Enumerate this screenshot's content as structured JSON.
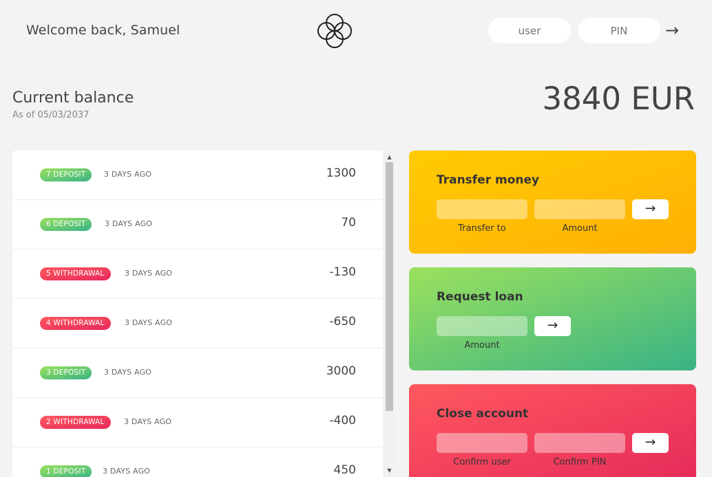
{
  "header": {
    "welcome": "Welcome back, Samuel",
    "user_placeholder": "user",
    "pin_placeholder": "PIN",
    "login_arrow": "→"
  },
  "balance": {
    "title": "Current balance",
    "date_prefix": "As of 05/03/2037",
    "value": "3840 EUR"
  },
  "movements": [
    {
      "badge": "7 deposit",
      "type": "deposit",
      "when": "3 DAYS AGO",
      "amount": "1300"
    },
    {
      "badge": "6 deposit",
      "type": "deposit",
      "when": "3 DAYS AGO",
      "amount": "70"
    },
    {
      "badge": "5 withdrawal",
      "type": "withdrawal",
      "when": "3 DAYS AGO",
      "amount": "-130"
    },
    {
      "badge": "4 withdrawal",
      "type": "withdrawal",
      "when": "3 DAYS AGO",
      "amount": "-650"
    },
    {
      "badge": "3 deposit",
      "type": "deposit",
      "when": "3 DAYS AGO",
      "amount": "3000"
    },
    {
      "badge": "2 withdrawal",
      "type": "withdrawal",
      "when": "3 DAYS AGO",
      "amount": "-400"
    },
    {
      "badge": "1 deposit",
      "type": "deposit",
      "when": "3 DAYS AGO",
      "amount": "450"
    }
  ],
  "operations": {
    "transfer": {
      "title": "Transfer money",
      "label_to": "Transfer to",
      "label_amount": "Amount",
      "button": "→"
    },
    "loan": {
      "title": "Request loan",
      "label_amount": "Amount",
      "button": "→"
    },
    "close": {
      "title": "Close account",
      "label_user": "Confirm user",
      "label_pin": "Confirm PIN",
      "button": "→"
    }
  },
  "colors": {
    "deposit": "#9be15d",
    "withdrawal": "#ff585f",
    "transfer": "#ffcb03",
    "loan": "#6fce73",
    "close": "#f2435e"
  }
}
